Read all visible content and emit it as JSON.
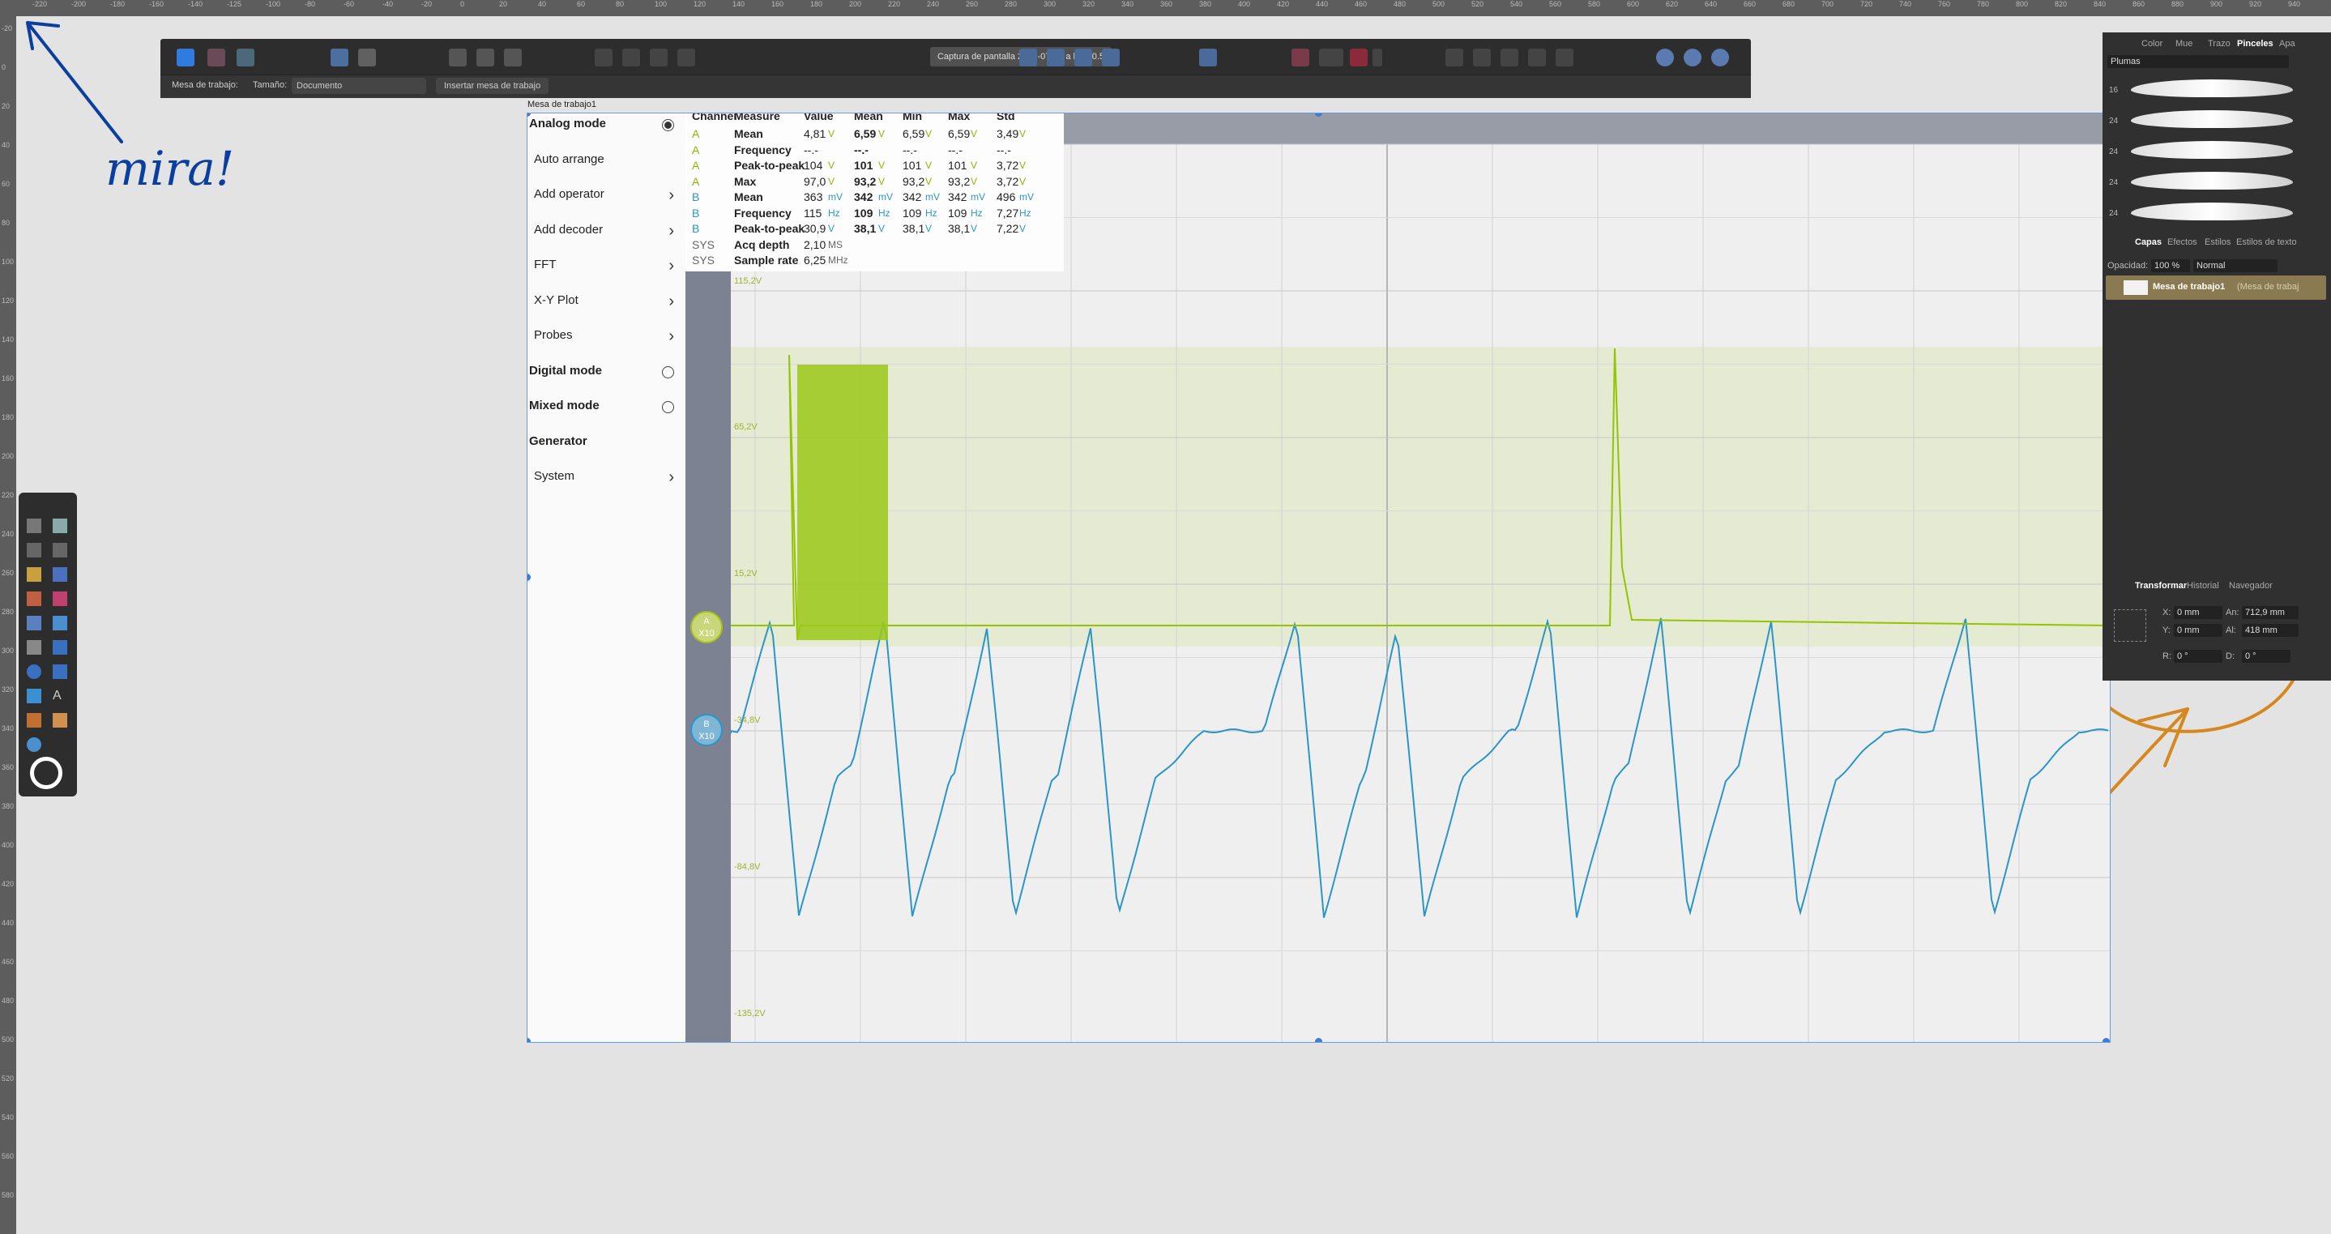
{
  "rulers": {
    "top": [
      "-220",
      "-200",
      "-180",
      "-160",
      "-140",
      "-125",
      "-100",
      "-80",
      "-60",
      "-40",
      "-20",
      "0",
      "20",
      "40",
      "60",
      "80",
      "100",
      "120",
      "140",
      "160",
      "180",
      "200",
      "220",
      "240",
      "260",
      "280",
      "300",
      "320",
      "340",
      "360",
      "380",
      "400",
      "420",
      "440",
      "460",
      "480",
      "500",
      "520",
      "540",
      "560",
      "580",
      "600",
      "620",
      "640",
      "660",
      "680",
      "700",
      "720",
      "740",
      "760",
      "780",
      "800",
      "820",
      "840",
      "860",
      "880",
      "900",
      "920",
      "940"
    ],
    "left": [
      "-20",
      "0",
      "20",
      "40",
      "60",
      "80",
      "100",
      "120",
      "140",
      "160",
      "180",
      "200",
      "220",
      "240",
      "260",
      "280",
      "300",
      "320",
      "340",
      "360",
      "380",
      "400",
      "420",
      "440",
      "460",
      "480",
      "500",
      "520",
      "540",
      "560",
      "580"
    ]
  },
  "annotations": {
    "handwriting_note": "mira!",
    "stroke_color": "#0a3fa0",
    "highlight_color": "#d7871f"
  },
  "toolbar": {
    "document_title": "Captura de pantalla 2019-07-10 a las 10.5",
    "context": {
      "workspace_label": "Mesa de trabajo:",
      "size_label": "Tamaño:",
      "size_value": "Documento",
      "insert_artboard_button": "Insertar mesa de trabajo"
    }
  },
  "artboard": {
    "name": "Mesa de trabajo1"
  },
  "scope_menu": {
    "items": [
      {
        "label": "Analog mode",
        "bold": true,
        "control": "radio-on"
      },
      {
        "label": "Auto arrange",
        "bold": false,
        "control": "none"
      },
      {
        "label": "Add operator",
        "bold": false,
        "control": "chevron"
      },
      {
        "label": "Add decoder",
        "bold": false,
        "control": "chevron"
      },
      {
        "label": "FFT",
        "bold": false,
        "control": "chevron"
      },
      {
        "label": "X-Y Plot",
        "bold": false,
        "control": "chevron"
      },
      {
        "label": "Probes",
        "bold": false,
        "control": "chevron"
      },
      {
        "label": "Digital mode",
        "bold": true,
        "control": "radio-off"
      },
      {
        "label": "Mixed mode",
        "bold": true,
        "control": "radio-off"
      },
      {
        "label": "Generator",
        "bold": true,
        "control": "none"
      },
      {
        "label": "System",
        "bold": false,
        "control": "chevron"
      }
    ]
  },
  "measure_table": {
    "headers": [
      "Channel",
      "Measure",
      "Value",
      "Mean",
      "Min",
      "Max",
      "Std"
    ],
    "rows": [
      {
        "ch": "A",
        "measure": "Mean",
        "value": "4,81",
        "vu": "V",
        "mean": "6,59",
        "mu": "V",
        "min": "6,59",
        "minu": "V",
        "max": "6,59",
        "maxu": "V",
        "std": "3,49",
        "stdu": "V"
      },
      {
        "ch": "A",
        "measure": "Frequency",
        "value": "--.-",
        "vu": "",
        "mean": "--.-",
        "mu": "",
        "min": "--.-",
        "minu": "",
        "max": "--.-",
        "maxu": "",
        "std": "--.-",
        "stdu": ""
      },
      {
        "ch": "A",
        "measure": "Peak-to-peak",
        "value": "104",
        "vu": "V",
        "mean": "101",
        "mu": "V",
        "min": "101",
        "minu": "V",
        "max": "101",
        "maxu": "V",
        "std": "3,72",
        "stdu": "V"
      },
      {
        "ch": "A",
        "measure": "Max",
        "value": "97,0",
        "vu": "V",
        "mean": "93,2",
        "mu": "V",
        "min": "93,2",
        "minu": "V",
        "max": "93,2",
        "maxu": "V",
        "std": "3,72",
        "stdu": "V"
      },
      {
        "ch": "B",
        "measure": "Mean",
        "value": "363",
        "vu": "mV",
        "mean": "342",
        "mu": "mV",
        "min": "342",
        "minu": "mV",
        "max": "342",
        "maxu": "mV",
        "std": "496",
        "stdu": "mV"
      },
      {
        "ch": "B",
        "measure": "Frequency",
        "value": "115",
        "vu": "Hz",
        "mean": "109",
        "mu": "Hz",
        "min": "109",
        "minu": "Hz",
        "max": "109",
        "maxu": "Hz",
        "std": "7,27",
        "stdu": "Hz"
      },
      {
        "ch": "B",
        "measure": "Peak-to-peak",
        "value": "30,9",
        "vu": "V",
        "mean": "38,1",
        "mu": "V",
        "min": "38,1",
        "minu": "V",
        "max": "38,1",
        "maxu": "V",
        "std": "7,22",
        "stdu": "V"
      },
      {
        "ch": "SYS",
        "measure": "Acq depth",
        "value": "2,10",
        "vu": "MS",
        "mean": "",
        "mu": "",
        "min": "",
        "minu": "",
        "max": "",
        "maxu": "",
        "std": "",
        "stdu": ""
      },
      {
        "ch": "SYS",
        "measure": "Sample rate",
        "value": "6,25",
        "vu": "MHz",
        "mean": "",
        "mu": "",
        "min": "",
        "minu": "",
        "max": "",
        "maxu": "",
        "std": "",
        "stdu": ""
      }
    ],
    "colors": {
      "A": "#8db600",
      "B": "#2a95c8",
      "SYS": "#666666"
    }
  },
  "scope": {
    "y_labels": [
      "115,2V",
      "65,2V",
      "15,2V",
      "-34,8V",
      "-84,8V",
      "-135,2V"
    ],
    "channel_a_marker": {
      "letter": "A",
      "scale": "X10",
      "color": "#a5c01b"
    },
    "channel_b_marker": {
      "letter": "B",
      "scale": "X10",
      "color": "#2a95c8"
    }
  },
  "right_panel": {
    "top_tabs": [
      "Color",
      "Mue",
      "Trazo",
      "Pinceles",
      "Apa"
    ],
    "active_top_tab": "Pinceles",
    "brush_category": "Plumas",
    "brush_sizes": [
      "16",
      "24",
      "24",
      "24",
      "24"
    ],
    "layer_tabs": [
      "Capas",
      "Efectos",
      "Estilos",
      "Estilos de texto"
    ],
    "opacity_label": "Opacidad:",
    "opacity_value": "100 %",
    "blend_mode": "Normal",
    "layer_name": "Mesa de trabajo1",
    "layer_type": "(Mesa de trabaj",
    "transform_tabs": [
      "Transformar",
      "Historial",
      "Navegador"
    ],
    "transform": {
      "x_label": "X:",
      "x_value": "0 mm",
      "y_label": "Y:",
      "y_value": "0 mm",
      "w_label": "An:",
      "w_value": "712,9 mm",
      "h_label": "Al:",
      "h_value": "418 mm",
      "r_label": "R:",
      "r_value": "0 °",
      "s_label": "D:",
      "s_value": "0 °"
    }
  }
}
